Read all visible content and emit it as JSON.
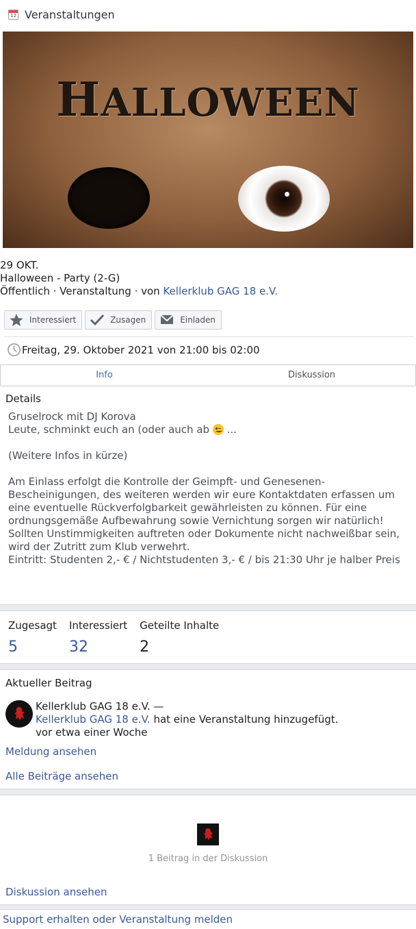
{
  "header": {
    "title": "Veranstaltungen",
    "icon": "calendar-icon",
    "icon_day": "12"
  },
  "cover": {
    "title_big": "H",
    "title_rest": "ALLOWEEN"
  },
  "event": {
    "date_short": "29 OKT.",
    "title": "Halloween - Party (2-G)",
    "meta_prefix": "Öffentlich · Veranstaltung · von",
    "host": "Kellerklub GAG 18 e.V."
  },
  "actions": {
    "interested": "Interessiert",
    "going": "Zusagen",
    "invite": "Einladen"
  },
  "when": "Freitag, 29. Oktober 2021 von 21:00 bis 02:00",
  "tabs": [
    {
      "label": "Info"
    },
    {
      "label": "Diskussion"
    }
  ],
  "details": {
    "heading": "Details",
    "line1": "Gruselrock mit DJ Korova",
    "line2_prefix": "Leute, schminkt euch an (oder auch ab",
    "line2_suffix": " ...",
    "line3": "(Weitere Infos in kürze)",
    "paragraph1": "Am Einlass erfolgt die Kontrolle der Geimpft- und Genesenen-Bescheinigungen, des weiteren werden wir eure Kontaktdaten erfassen um eine eventuelle Rückverfolgbarkeit gewährleisten zu können. Für eine ordnungsgemäße Aufbewahrung sowie Vernichtung sorgen wir natürlich!",
    "paragraph2": "Sollten Unstimmigkeiten auftreten oder Dokumente nicht nachweißbar sein, wird der Zutritt zum Klub verwehrt.",
    "paragraph3": "Eintritt: Studenten 2,- € / Nichtstudenten 3,- € / bis 21:30 Uhr je halber Preis"
  },
  "stats": [
    {
      "label": "Zugesagt",
      "value": "5"
    },
    {
      "label": "Interessiert",
      "value": "32"
    },
    {
      "label": "Geteilte Inhalte",
      "value": "2"
    }
  ],
  "recent": {
    "heading": "Aktueller Beitrag",
    "author": "Kellerklub GAG 18 e.V. —",
    "actor": "Kellerklub GAG 18 e.V.",
    "action": " hat eine Veranstaltung hinzugefügt.",
    "time": "vor etwa einer Woche",
    "view_post": "Meldung ansehen",
    "view_all": "Alle Beiträge ansehen"
  },
  "discussion": {
    "count_text": "1 Beitrag in der Diskussion",
    "view": "Diskussion ansehen"
  },
  "footer": {
    "support": "Support erhalten oder Veranstaltung melden"
  }
}
